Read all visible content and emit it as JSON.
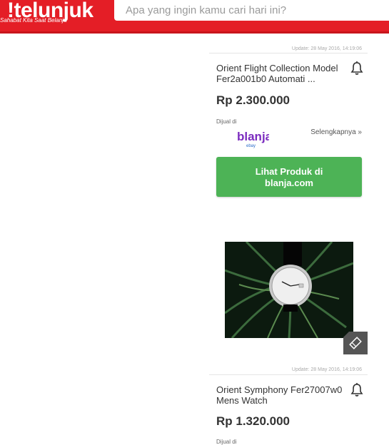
{
  "header": {
    "logo_text": "telunjuk",
    "logo_mark": "!",
    "tagline": "Sahabat Kita Saat Belanja",
    "search_placeholder": "Apa yang ingin kamu cari hari ini?",
    "brand_color": "#e41e26"
  },
  "products": [
    {
      "update": "Update: 28 May 2016, 14:19:06",
      "title": "Orient Flight Collection Model Fer2a001b0 Automati ...",
      "price": "Rp 2.300.000",
      "sold_at": "Dijual di",
      "store": "blanja",
      "store_sub": "ebay",
      "more": "Selengkapnya »",
      "cta": "Lihat Produk di blanja.com"
    },
    {
      "update": "Update: 28 May 2016, 14:19:06",
      "title": "Orient Symphony Fer27007w0 Mens Watch",
      "price": "Rp 1.320.000",
      "sold_at": "Dijual di"
    }
  ],
  "icons": {
    "bell": "bell-icon",
    "tag": "tag-icon"
  },
  "colors": {
    "cta_green": "#4db356"
  }
}
